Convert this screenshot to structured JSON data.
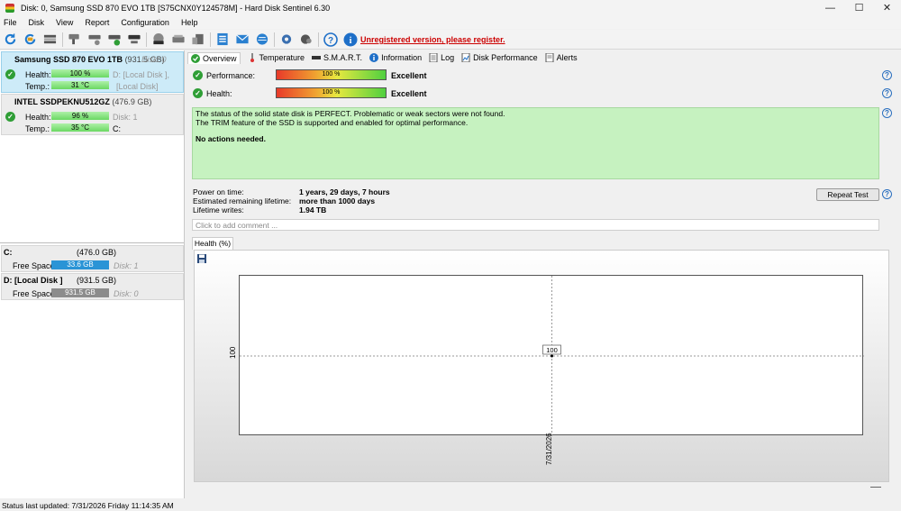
{
  "window": {
    "title": "Disk: 0, Samsung SSD 870 EVO 1TB [S75CNX0Y124578M]  -  Hard Disk Sentinel 6.30",
    "minimize": "—",
    "maximize": "☐",
    "close": "✕"
  },
  "menu": [
    "File",
    "Disk",
    "View",
    "Report",
    "Configuration",
    "Help"
  ],
  "toolbar": {
    "register_link": "Unregistered version, please register."
  },
  "disks": [
    {
      "name": "Samsung SSD 870 EVO 1TB",
      "size": "(931.5 GB)",
      "disk_no": "Disk: 0",
      "health_label": "Health:",
      "health": "100 %",
      "health_pct": 100,
      "drive_letter": "D: [Local Disk ],",
      "temp_label": "Temp.:",
      "temp": "31 °C",
      "temp_loc": "[Local Disk]"
    },
    {
      "name": "INTEL SSDPEKNU512GZ",
      "size": "(476.9 GB)",
      "health_label": "Health:",
      "health": "96 %",
      "health_pct": 96,
      "disk_no": "Disk: 1",
      "temp_label": "Temp.:",
      "temp": "35 °C",
      "temp_loc": "C:"
    }
  ],
  "volumes": [
    {
      "name": "C:",
      "size": "(476.0 GB)",
      "free_label": "Free Space",
      "free": "33.6 GB",
      "disk_no": "Disk: 1",
      "color": "#2a94d6"
    },
    {
      "name": "D: [Local Disk ]",
      "size": "(931.5 GB)",
      "free_label": "Free Space",
      "free": "931.5 GB",
      "disk_no": "Disk: 0",
      "color": "#8c8c8c"
    }
  ],
  "tabs": [
    "Overview",
    "Temperature",
    "S.M.A.R.T.",
    "Information",
    "Log",
    "Disk Performance",
    "Alerts"
  ],
  "overview": {
    "performance_label": "Performance:",
    "performance_value": "100 %",
    "performance_rating": "Excellent",
    "health_label": "Health:",
    "health_value": "100 %",
    "health_rating": "Excellent",
    "status_line1": "The status of the solid state disk is PERFECT. Problematic or weak sectors were not found.",
    "status_line2": "The TRIM feature of the SSD is supported and enabled for optimal performance.",
    "status_action": "No actions needed.",
    "power_on_label": "Power on time:",
    "power_on_value": "1 years, 29 days, 7 hours",
    "lifetime_label": "Estimated remaining lifetime:",
    "lifetime_value": "more than 1000 days",
    "writes_label": "Lifetime writes:",
    "writes_value": "1.94 TB",
    "repeat_test": "Repeat Test",
    "comment_placeholder": "Click to add comment ..."
  },
  "chart_tab": "Health (%)",
  "chart_data": {
    "type": "line",
    "x": [
      "7/31/2026"
    ],
    "series": [
      {
        "values": [
          100
        ]
      }
    ],
    "ylabel": "",
    "xlabel": "",
    "y_tick": "100",
    "x_tick": "7/31/2026",
    "point_label": "100"
  },
  "statusbar": "Status last updated: 7/31/2026 Friday 11:14:35 AM"
}
